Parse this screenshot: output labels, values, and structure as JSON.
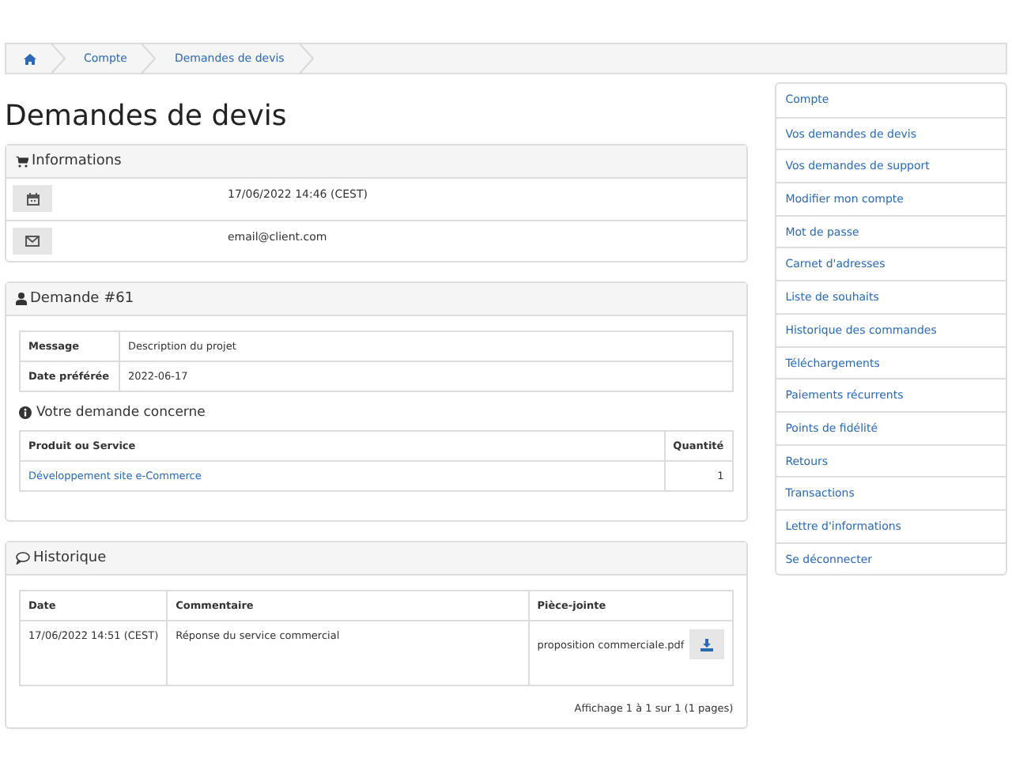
{
  "breadcrumb": [
    {
      "kind": "home"
    },
    {
      "kind": "text",
      "label": "Compte"
    },
    {
      "kind": "text",
      "label": "Demandes de devis"
    }
  ],
  "page_title": "Demandes de devis",
  "info_panel": {
    "title": "Informations",
    "rows": [
      {
        "kind": "calendar",
        "value": "17/06/2022 14:46 (CEST)"
      },
      {
        "kind": "mail",
        "value": "email@client.com"
      }
    ]
  },
  "request_panel": {
    "title": "Demande #61",
    "details": [
      {
        "label": "Message",
        "value": "Description du projet"
      },
      {
        "label": "Date préférée",
        "value": "2022-06-17"
      }
    ],
    "concerns_title": "Votre demande concerne",
    "columns": [
      "Produit ou Service",
      "Quantité"
    ],
    "rows": [
      {
        "product": "Développement site e-Commerce",
        "quantity": "1"
      }
    ]
  },
  "history_panel": {
    "title": "Historique",
    "columns": [
      "Date",
      "Commentaire",
      "Pièce-jointe"
    ],
    "rows": [
      {
        "date": "17/06/2022 14:51 (CEST)",
        "comment": "Réponse du service commercial",
        "attachment": "proposition commerciale.pdf"
      }
    ],
    "pagination": "Affichage 1 à 1 sur 1 (1 pages)"
  },
  "sidebar": {
    "items": [
      "Compte",
      "Vos demandes de devis",
      "Vos demandes de support",
      "Modifier mon compte",
      "Mot de passe",
      "Carnet d'adresses",
      "Liste de souhaits",
      "Historique des commandes",
      "Téléchargements",
      "Paiements récurrents",
      "Points de fidélité",
      "Retours",
      "Transactions",
      "Lettre d'informations",
      "Se déconnecter"
    ]
  }
}
